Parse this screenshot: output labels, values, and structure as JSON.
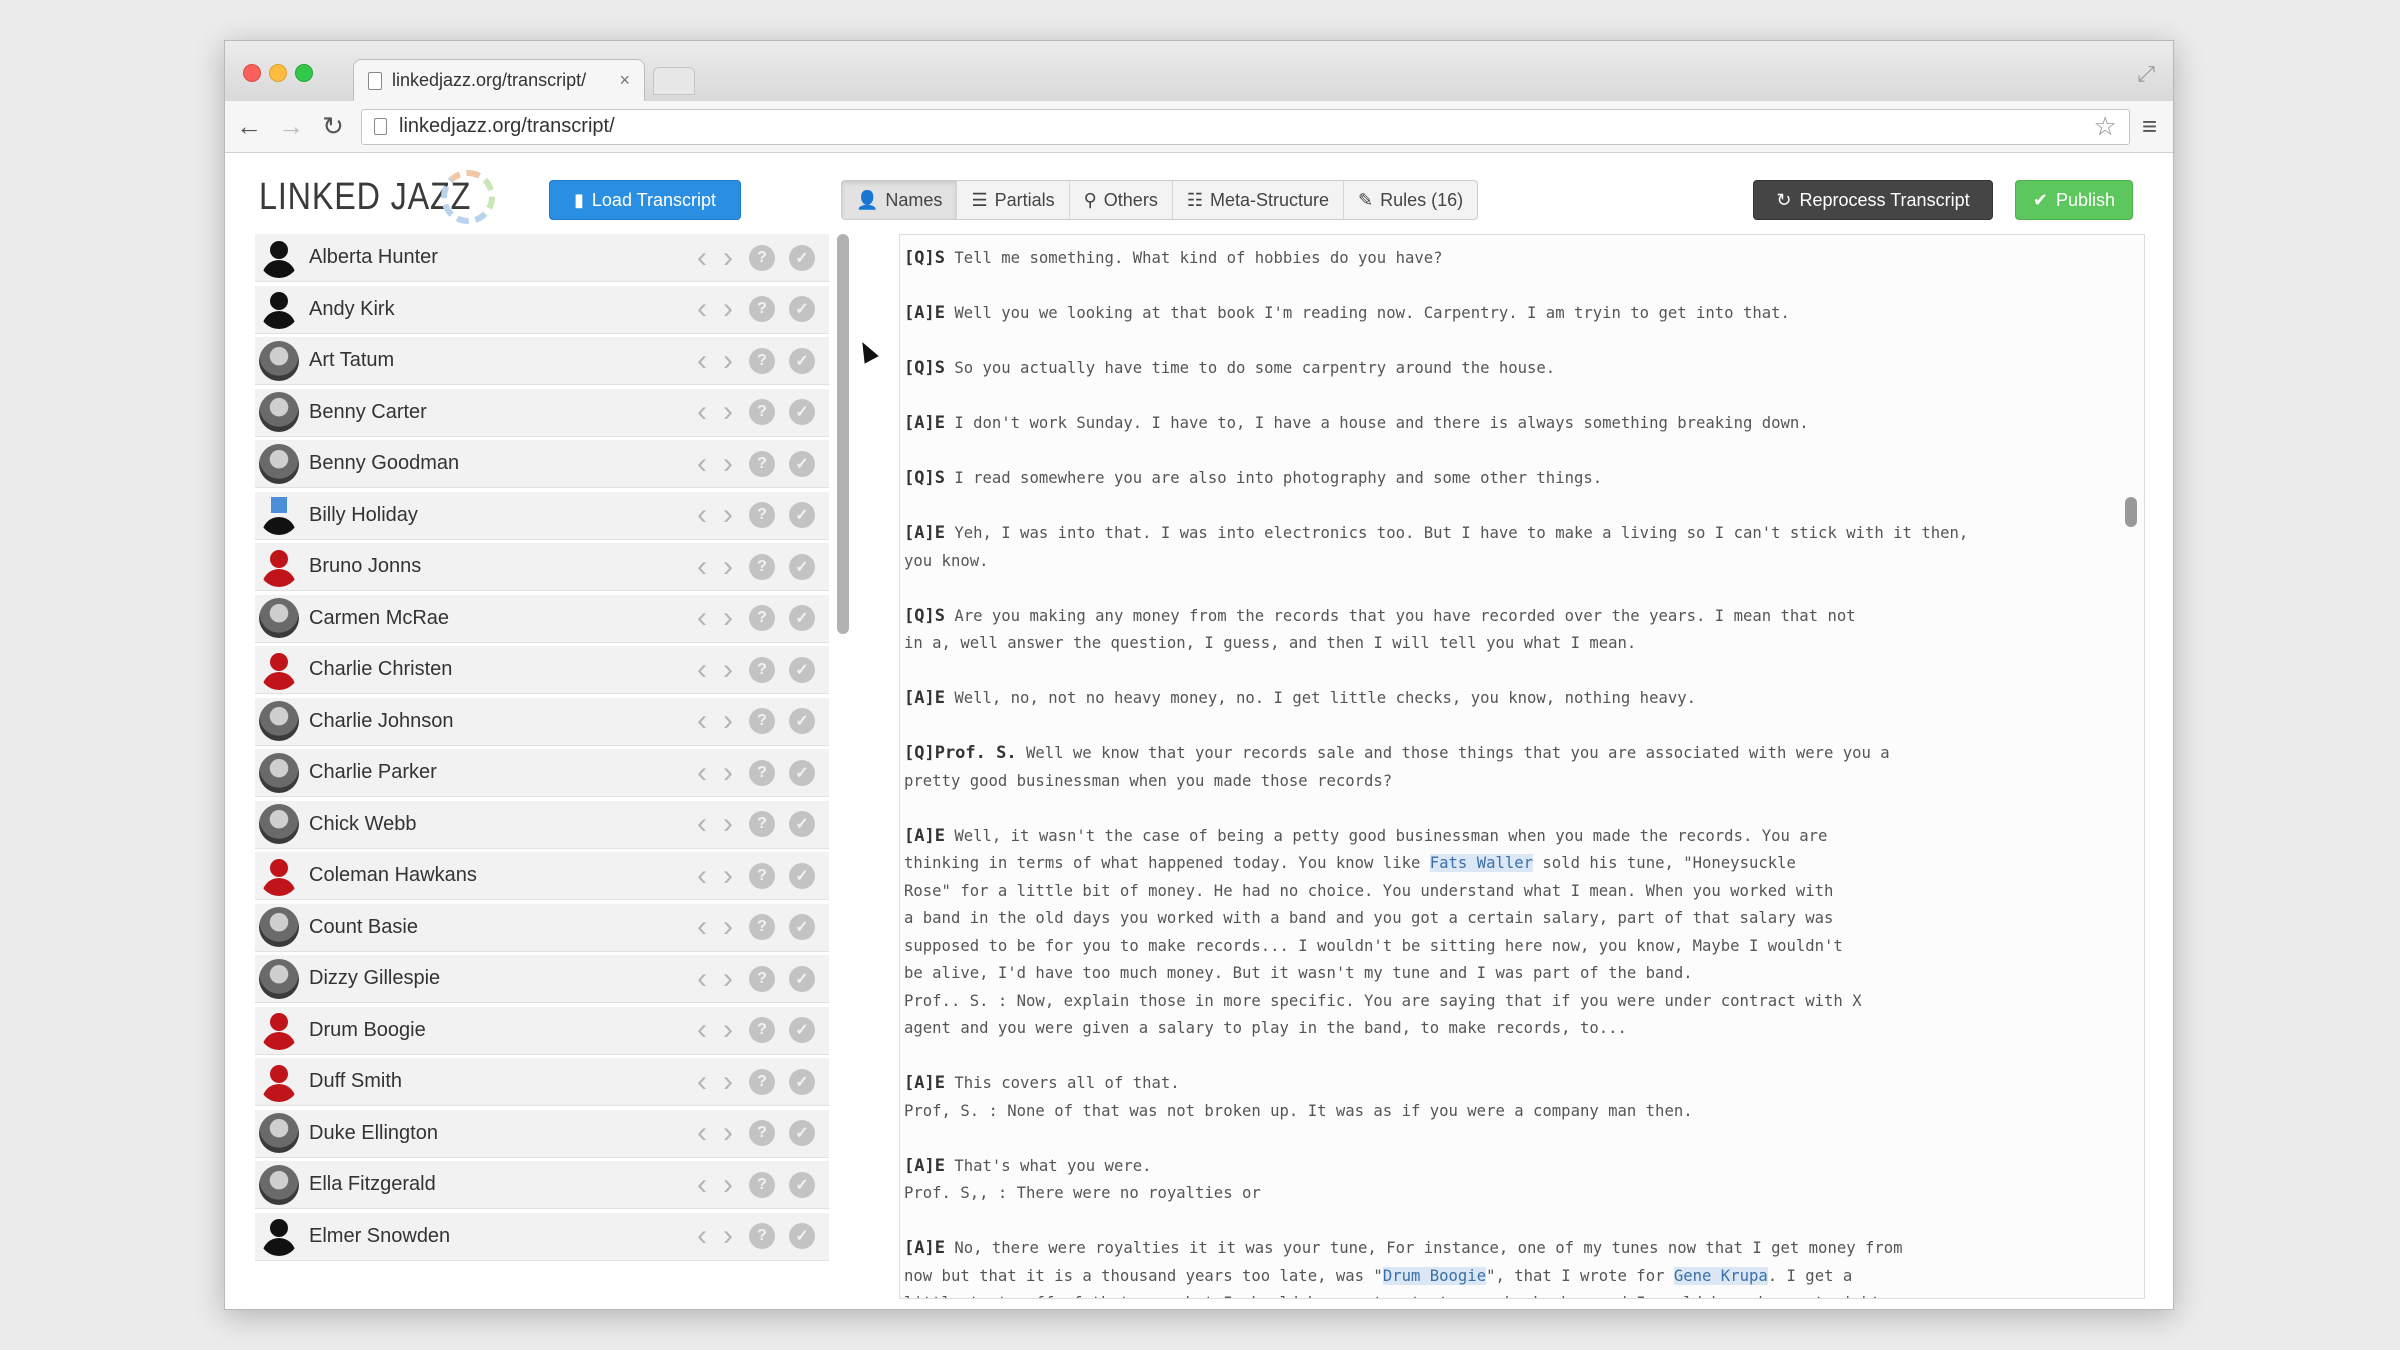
{
  "browser": {
    "tab_title": "linkedjazz.org/transcript/",
    "tab_close": "×",
    "url": "linkedjazz.org/transcript/"
  },
  "app": {
    "logo_text": "LINKED JAZZ",
    "load_button": "Load Transcript",
    "reprocess_button": "Reprocess Transcript",
    "publish_button": "Publish",
    "tabs": [
      {
        "label": "Names",
        "active": true
      },
      {
        "label": "Partials",
        "active": false
      },
      {
        "label": "Others",
        "active": false
      },
      {
        "label": "Meta-Structure",
        "active": false
      },
      {
        "label": "Rules (16)",
        "active": false
      }
    ]
  },
  "names": [
    {
      "name": "Alberta Hunter",
      "avatar": "black"
    },
    {
      "name": "Andy Kirk",
      "avatar": "black"
    },
    {
      "name": "Art Tatum",
      "avatar": "photo"
    },
    {
      "name": "Benny Carter",
      "avatar": "photo"
    },
    {
      "name": "Benny Goodman",
      "avatar": "photo"
    },
    {
      "name": "Billy Holiday",
      "avatar": "blue"
    },
    {
      "name": "Bruno Jonns",
      "avatar": "red"
    },
    {
      "name": "Carmen McRae",
      "avatar": "photo"
    },
    {
      "name": "Charlie Christen",
      "avatar": "red"
    },
    {
      "name": "Charlie Johnson",
      "avatar": "photo"
    },
    {
      "name": "Charlie Parker",
      "avatar": "photo"
    },
    {
      "name": "Chick Webb",
      "avatar": "photo"
    },
    {
      "name": "Coleman Hawkans",
      "avatar": "red"
    },
    {
      "name": "Count Basie",
      "avatar": "photo"
    },
    {
      "name": "Dizzy Gillespie",
      "avatar": "photo"
    },
    {
      "name": "Drum Boogie",
      "avatar": "red"
    },
    {
      "name": "Duff Smith",
      "avatar": "red"
    },
    {
      "name": "Duke Ellington",
      "avatar": "photo"
    },
    {
      "name": "Ella Fitzgerald",
      "avatar": "photo"
    },
    {
      "name": "Elmer Snowden",
      "avatar": "black"
    }
  ],
  "row_controls": {
    "prev": "‹",
    "next": "›",
    "question": "?",
    "ok": "✓"
  },
  "transcript": [
    {
      "speaker": "[Q]S",
      "text": " Tell me something. What kind of hobbies do you have?"
    },
    {
      "speaker": "[A]E",
      "text": " Well you we looking at that book I'm reading now. Carpentry. I am tryin to get into that."
    },
    {
      "speaker": "[Q]S",
      "text": " So you actually have time to do some carpentry around the house."
    },
    {
      "speaker": "[A]E",
      "text": " I don't work Sunday. I have to, I have a house and there is always something breaking down."
    },
    {
      "speaker": "[Q]S",
      "text": " I read somewhere you are also into photography and some other things."
    },
    {
      "speaker": "[A]E",
      "text": " Yeh, I was into that. I was into electronics too. But I have to make a living so I can't stick with it then,\nyou know."
    },
    {
      "speaker": "[Q]S",
      "text": " Are you making any money from the records that you have recorded over the years. I mean that not\nin a, well answer the question, I guess, and then I will tell you what I mean."
    },
    {
      "speaker": "[A]E",
      "text": " Well, no, not no heavy money, no. I get little checks, you know, nothing heavy."
    },
    {
      "speaker": "[Q]Prof. S.",
      "text": " Well we know that your records sale and those things that you are associated with were you a\npretty good businessman when you made those records?"
    },
    {
      "speaker": "[A]E",
      "text": " Well, it wasn't the case of being a petty good businessman when you made the records. You are\nthinking in terms of what happened today. You know like ",
      "hl": "Fats Waller",
      "after": " sold his tune, \"Honeysuckle\nRose\" for a little bit of money. He had no choice. You understand what I mean. When you worked with\na band in the old days you worked with a band and you got a certain salary, part of that salary was\nsupposed to be for you to make records... I wouldn't be sitting here now, you know, Maybe I wouldn't\nbe alive, I'd have too much money. But it wasn't my tune and I was part of the band.\nProf.. S. : Now, explain those in more specific. You are saying that if you were under contract with X\nagent and you were given a salary to play in the band, to make records, to..."
    },
    {
      "speaker": "[A]E",
      "text": " This covers all of that.\nProf, S. : None of that was not broken up. It was as if you were a company man then."
    },
    {
      "speaker": "[A]E",
      "text": " That's what you were.\nProf. S,, : There were no royalties or"
    },
    {
      "speaker": "[A]E",
      "text": " No, there were royalties it it was your tune, For instance, one of my tunes now that I get money from\nnow but that it is a thousand years too late, was \"",
      "hl": "Drum Boogie",
      "after": "\", that I wrote for ",
      "hl2": "Gene Krupa",
      "after2": ". I get a\nlittle taste off of that now, but I should have got a taste way back when and I would have been straight"
    }
  ]
}
